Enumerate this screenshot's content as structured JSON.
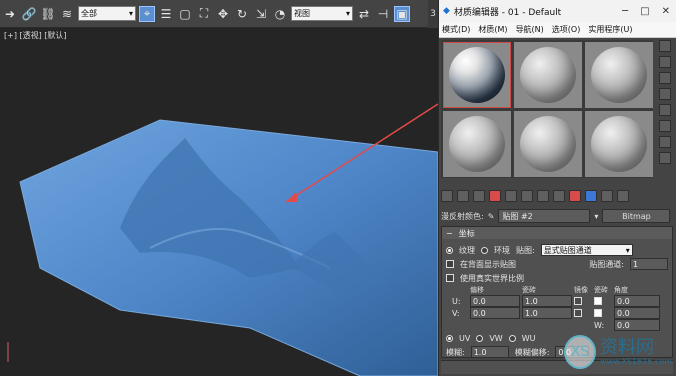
{
  "toolbar": {
    "left_icons": [
      "pointer-icon",
      "link-icon",
      "unlink-icon",
      "bind-icon"
    ],
    "filter_select": "全部",
    "view_select": "视图",
    "tab_right_label": "3"
  },
  "viewport": {
    "label": "[+] [透视] [默认]",
    "background": "#252525",
    "terrain_color": "#4e86c8",
    "arrow_color": "#e34b4b"
  },
  "material_editor": {
    "title": "材质编辑器 - 01 - Default",
    "window_controls": [
      "─",
      "□",
      "✕"
    ],
    "menu": [
      "模式(D)",
      "材质(M)",
      "导航(N)",
      "选项(O)",
      "实用程序(U)"
    ],
    "slots": [
      {
        "type": "textured",
        "selected": true
      },
      {
        "type": "gray",
        "selected": false
      },
      {
        "type": "gray",
        "selected": false
      },
      {
        "type": "gray",
        "selected": false
      },
      {
        "type": "gray",
        "selected": false
      },
      {
        "type": "gray",
        "selected": false
      }
    ],
    "map_row": {
      "label": "漫反射颜色:",
      "map_name": "贴图 #2",
      "map_type": "Bitmap"
    },
    "rollout": {
      "title": "坐标",
      "texture_label": "纹理",
      "environment_label": "环境",
      "mapping_label": "贴图:",
      "mapping_value": "显式贴图通道",
      "show_background_label": "在背面显示贴图",
      "map_channel_label": "贴图通道:",
      "map_channel_value": "1",
      "real_world_label": "使用真实世界比例",
      "col_offset": "偏移",
      "col_tiling": "瓷砖",
      "col_mirror": "镜像",
      "col_tile": "瓷砖",
      "col_angle": "角度",
      "rows": [
        {
          "axis": "U:",
          "offset": "0.0",
          "tiling": "1.0",
          "mirror": false,
          "tile": true,
          "angle_axis": "U:",
          "angle": "0.0"
        },
        {
          "axis": "V:",
          "offset": "0.0",
          "tiling": "1.0",
          "mirror": false,
          "tile": true,
          "angle_axis": "V:",
          "angle": "0.0"
        },
        {
          "axis": "",
          "offset": "",
          "tiling": "",
          "mirror": false,
          "tile": false,
          "angle_axis": "W:",
          "angle": "0.0"
        }
      ],
      "uvw_labels": [
        "UV",
        "VW",
        "WU"
      ],
      "blur_label": "模糊:",
      "blur_value": "1.0",
      "blur_offset_label": "模糊偏移:",
      "blur_offset_value": "0.0"
    }
  },
  "watermark": {
    "main": "资料网",
    "sub": "www.XS1616.com",
    "mark": "XS"
  }
}
